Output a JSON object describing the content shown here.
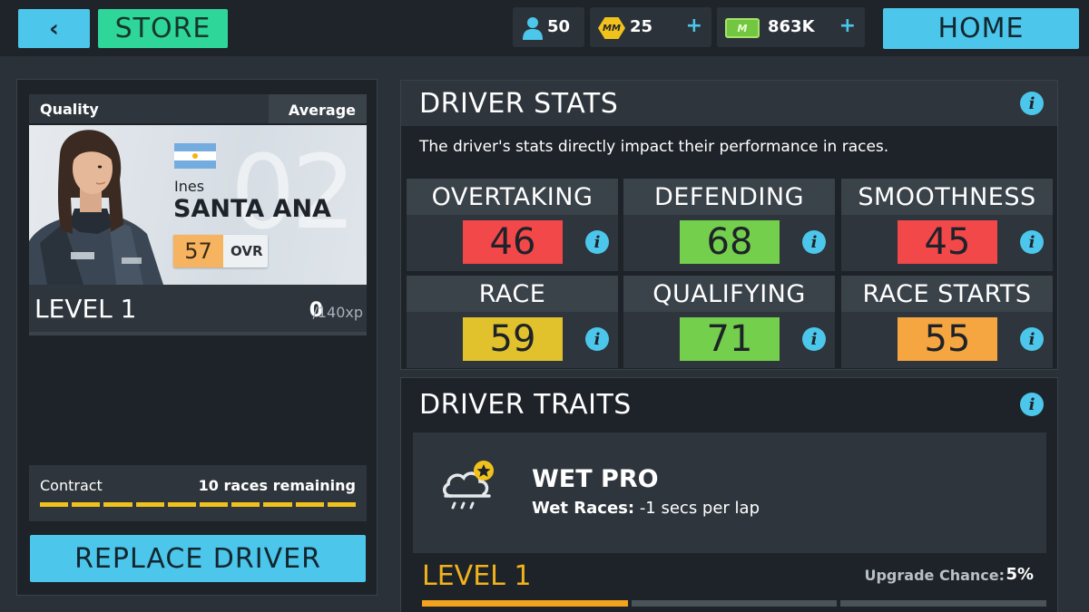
{
  "topbar": {
    "back_label": "‹",
    "store_label": "STORE",
    "drivers_count": "50",
    "tokens_count": "25",
    "money_amount": "863K",
    "plus_label": "+",
    "home_label": "HOME",
    "token_icon_text": "MM",
    "money_icon_text": "M"
  },
  "driver": {
    "quality_label": "Quality",
    "quality_value": "Average",
    "first_name": "Ines",
    "last_name": "SANTA ANA",
    "car_number": "02",
    "ovr_value": "57",
    "ovr_label": "OVR",
    "level_label": "LEVEL 1",
    "xp_current": "0",
    "xp_max": "/140xp",
    "contract_label": "Contract",
    "contract_value": "10 races remaining",
    "contract_segments": 10,
    "replace_label": "REPLACE DRIVER"
  },
  "stats": {
    "title": "DRIVER STATS",
    "description": "The driver's stats directly impact their performance in races.",
    "items": [
      {
        "label": "OVERTAKING",
        "value": "46",
        "color": "#f2484a"
      },
      {
        "label": "DEFENDING",
        "value": "68",
        "color": "#74d04c"
      },
      {
        "label": "SMOOTHNESS",
        "value": "45",
        "color": "#f2484a"
      },
      {
        "label": "RACE",
        "value": "59",
        "color": "#e2c22c"
      },
      {
        "label": "QUALIFYING",
        "value": "71",
        "color": "#74d04c"
      },
      {
        "label": "RACE STARTS",
        "value": "55",
        "color": "#f6a640"
      }
    ]
  },
  "traits": {
    "title": "DRIVER TRAITS",
    "name": "WET PRO",
    "desc_label": "Wet Races:",
    "desc_value": " -1 secs per lap",
    "level_label": "LEVEL 1",
    "upgrade_label": "Upgrade Chance:",
    "upgrade_value": "5%",
    "level_segments_filled": 1,
    "level_segments_total": 3
  },
  "colors": {
    "accent": "#4cc6ea",
    "store": "#2fd69a",
    "gold": "#f2c21c"
  },
  "icons": [
    "back-chevron-icon",
    "person-icon",
    "token-icon",
    "money-icon",
    "info-icon",
    "argentina-flag-icon",
    "rain-cloud-star-icon"
  ]
}
